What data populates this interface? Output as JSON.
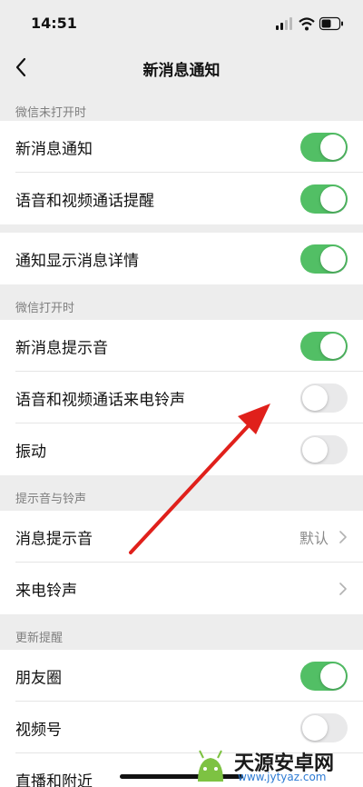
{
  "status_bar": {
    "time": "14:51"
  },
  "nav": {
    "title": "新消息通知"
  },
  "sections": {
    "wechat_closed": "微信未打开时",
    "wechat_open": "微信打开时",
    "sounds": "提示音与铃声",
    "updates": "更新提醒"
  },
  "rows": {
    "new_message_notify": {
      "label": "新消息通知",
      "on": true
    },
    "voice_video_alert": {
      "label": "语音和视频通话提醒",
      "on": true
    },
    "show_details": {
      "label": "通知显示消息详情",
      "on": true
    },
    "new_message_sound": {
      "label": "新消息提示音",
      "on": true
    },
    "call_ringtone": {
      "label": "语音和视频通话来电铃声",
      "on": false
    },
    "vibrate": {
      "label": "振动",
      "on": false
    },
    "message_sound": {
      "label": "消息提示音",
      "value": "默认"
    },
    "ringtone": {
      "label": "来电铃声"
    },
    "moments": {
      "label": "朋友圈",
      "on": true
    },
    "channels": {
      "label": "视频号",
      "on": false
    },
    "live_nearby": {
      "label": "直播和附近"
    }
  },
  "annotation": {
    "arrow_color": "#e0201b"
  },
  "watermark": {
    "name": "天源安卓网",
    "url": "www.jytyaz.com"
  },
  "colors": {
    "switch_on": "#52bf65",
    "switch_off": "#e9e9ea",
    "background": "#ededed"
  }
}
